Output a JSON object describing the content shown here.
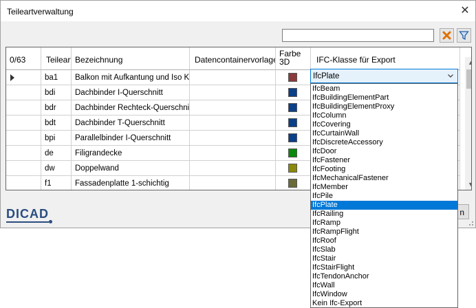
{
  "window": {
    "title": "Teileartverwaltung"
  },
  "toolbar": {
    "search_value": ""
  },
  "grid": {
    "corner_label": "0/63",
    "columns": {
      "teileart": "Teileart",
      "bezeichnung": "Bezeichnung",
      "datencontainer": "Datencontainervorlage",
      "farbe_line1": "Farbe",
      "farbe_line2": "3D",
      "ifc": "IFC-Klasse für Export"
    },
    "rows": [
      {
        "code": "ba1",
        "name": "Balkon mit Aufkantung und Iso K...",
        "container": "",
        "color": "#8b3a3a"
      },
      {
        "code": "bdi",
        "name": "Dachbinder I-Querschnitt",
        "container": "",
        "color": "#0a3f8a"
      },
      {
        "code": "bdr",
        "name": "Dachbinder Rechteck-Querschnitt",
        "container": "",
        "color": "#0a3f8a"
      },
      {
        "code": "bdt",
        "name": "Dachbinder T-Querschnitt",
        "container": "",
        "color": "#0a3f8a"
      },
      {
        "code": "bpi",
        "name": "Parallelbinder I-Querschnitt",
        "container": "",
        "color": "#0a3f8a"
      },
      {
        "code": "de",
        "name": "Filigrandecke",
        "container": "",
        "color": "#0a8a0a"
      },
      {
        "code": "dw",
        "name": "Doppelwand",
        "container": "",
        "color": "#8a8a0a"
      },
      {
        "code": "f1",
        "name": "Fassadenplatte 1-schichtig",
        "container": "",
        "color": "#6b6b3a"
      }
    ]
  },
  "ifc_combo": {
    "selected": "IfcPlate",
    "options": [
      "IfcBeam",
      "IfcBuildingElementPart",
      "IfcBuildingElementProxy",
      "IfcColumn",
      "IfcCovering",
      "IfcCurtainWall",
      "IfcDiscreteAccessory",
      "IfcDoor",
      "IfcFastener",
      "IfcFooting",
      "IfcMechanicalFastener",
      "IfcMember",
      "IfcPile",
      "IfcPlate",
      "IfcRailing",
      "IfcRamp",
      "IfcRampFlight",
      "IfcRoof",
      "IfcSlab",
      "IfcStair",
      "IfcStairFlight",
      "IfcTendonAnchor",
      "IfcWall",
      "IfcWindow",
      "Kein Ifc-Export"
    ],
    "highlighted_index": 13
  },
  "footer": {
    "logo": "DICAD",
    "ok_label": "n"
  },
  "colors": {
    "accent": "#0078d7",
    "logo": "#2a4d80",
    "clear": "#e07000",
    "filter": "#1f5fa8"
  }
}
